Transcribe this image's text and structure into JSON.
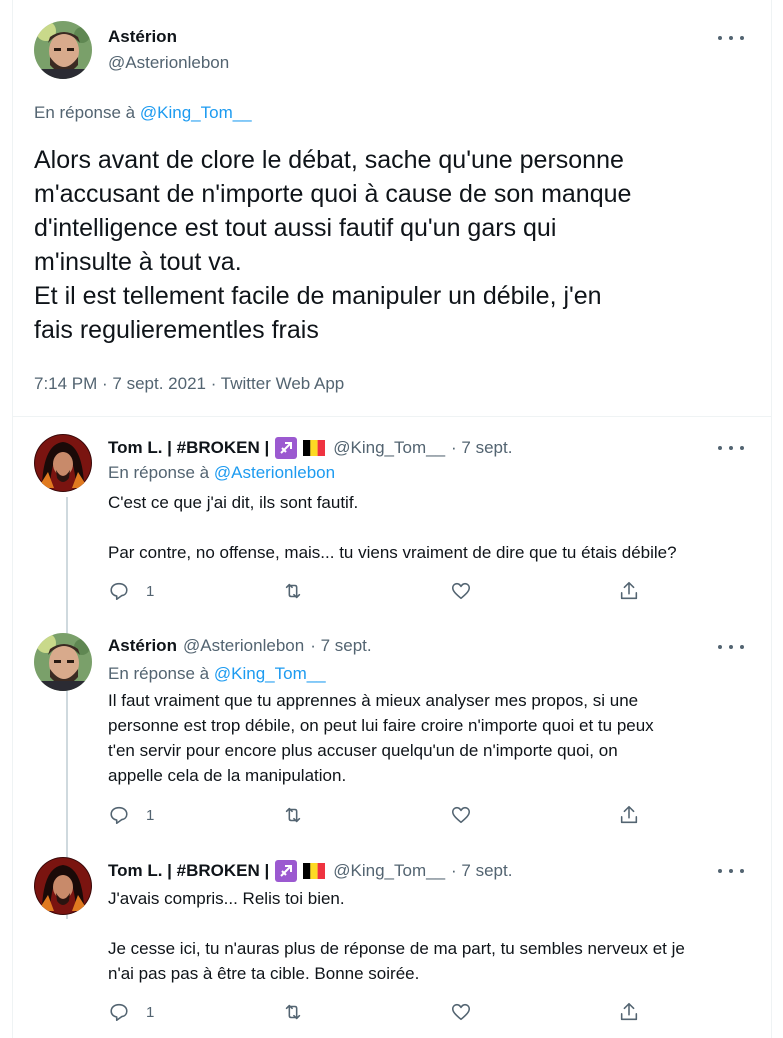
{
  "main_tweet": {
    "author_name": "Astérion",
    "author_handle": "@Asterionlebon",
    "reply_prefix": "En réponse à",
    "reply_mention": "@King_Tom__",
    "text_lines": [
      "Alors avant de clore le débat, sache qu'une personne",
      "m'accusant de n'importe quoi à cause de son manque",
      "d'intelligence est tout aussi fautif qu'un gars qui",
      "m'insulte à tout va.",
      "Et il est tellement facile de manipuler un débile, j'en",
      "fais regulierementles frais"
    ],
    "timestamp": "7:14 PM · 7 sept. 2021 · Twitter Web App"
  },
  "replies": [
    {
      "author_name": "Tom L. | #BROKEN |",
      "author_handle": "@King_Tom__",
      "date": "· 7 sept.",
      "reply_prefix": "En réponse à",
      "reply_mention": "@Asterionlebon",
      "text_lines": [
        "C'est ce que j'ai dit, ils sont fautif.",
        "",
        "Par contre, no offense, mais... tu viens vraiment de dire que tu étais débile?"
      ],
      "reply_count": "1"
    },
    {
      "author_name": "Astérion",
      "author_handle": "@Asterionlebon",
      "date": "· 7 sept.",
      "reply_prefix": "En réponse à",
      "reply_mention": "@King_Tom__",
      "text_lines": [
        "Il faut vraiment que tu apprennes à mieux analyser mes propos, si une",
        "personne est trop débile, on peut lui faire croire n'importe quoi et tu peux",
        "t'en servir pour encore plus accuser quelqu'un de n'importe quoi, on",
        "appelle cela de la manipulation."
      ],
      "reply_count": "1"
    },
    {
      "author_name": "Tom L. | #BROKEN |",
      "author_handle": "@King_Tom__",
      "date": "· 7 sept.",
      "text_lines": [
        "J'avais compris... Relis toi bien.",
        "",
        "Je cesse ici, tu n'auras plus de réponse de ma part, tu sembles nerveux et je",
        "n'ai pas pas à être ta cible. Bonne soirée."
      ],
      "reply_count": "1"
    }
  ],
  "icons": {
    "reply": "reply-icon",
    "retweet": "retweet-icon",
    "like": "heart-icon",
    "share": "share-icon",
    "more": "more-icon",
    "sagittarius": "sagittarius-emoji",
    "belgium_flag": "belgium-flag-emoji"
  },
  "colors": {
    "link": "#1d9bf0",
    "muted": "#536471",
    "text": "#0f1419",
    "thread_line": "#cfd9de",
    "sagittarius": "#9b59d0"
  }
}
